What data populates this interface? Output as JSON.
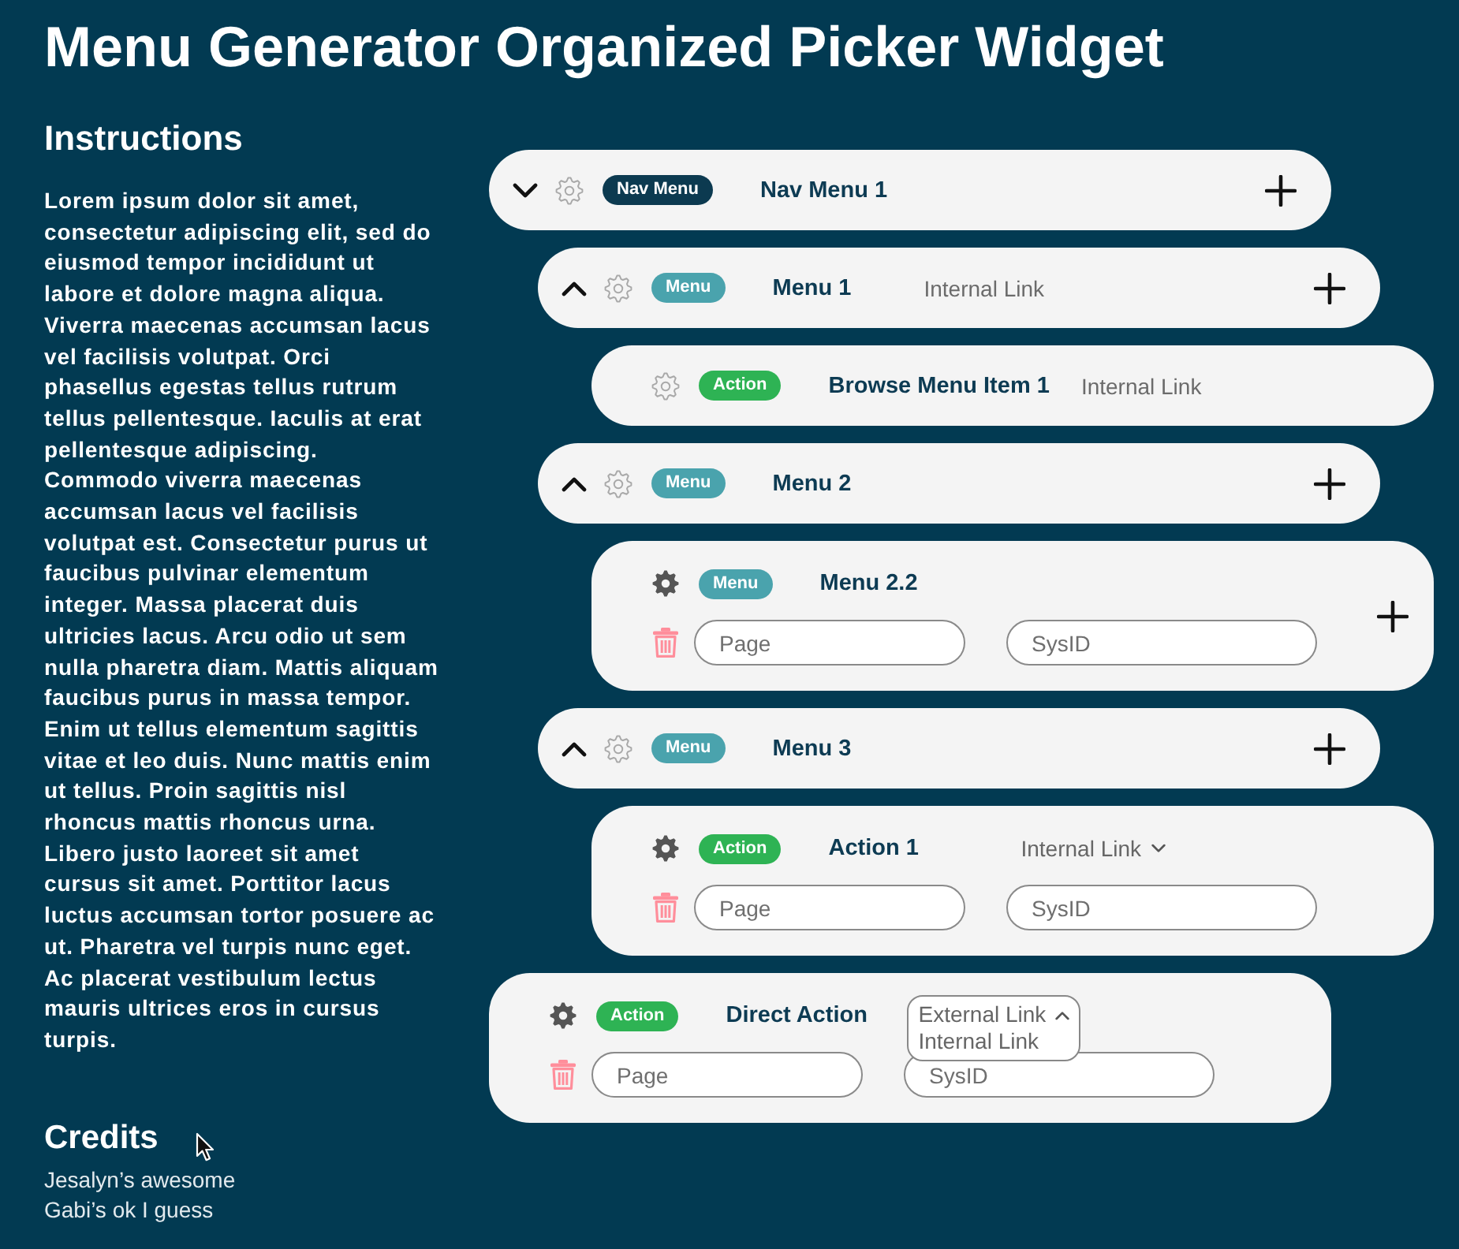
{
  "title": "Menu Generator Organized Picker Widget",
  "instructions": {
    "heading": "Instructions",
    "text": "Lorem ipsum dolor sit amet, consectetur adipiscing elit, sed do eiusmod tempor incididunt ut labore et dolore magna aliqua. Viverra maecenas accumsan lacus vel facilisis volutpat. Orci phasellus egestas tellus rutrum tellus pellentesque. Iaculis at erat pellentesque adipiscing. Commodo viverra maecenas accumsan lacus vel facilisis volutpat est. Consectetur purus ut faucibus pulvinar elementum integer. Massa placerat duis ultricies lacus. Arcu odio ut sem nulla pharetra diam. Mattis aliquam faucibus purus in massa tempor. Enim ut tellus elementum sagittis vitae et leo duis. Nunc mattis enim ut tellus. Proin sagittis nisl rhoncus mattis rhoncus urna. Libero justo laoreet sit amet cursus sit amet. Porttitor lacus luctus accumsan tortor posuere ac ut. Pharetra vel turpis nunc eget. Ac placerat vestibulum lectus mauris ultrices eros in cursus turpis."
  },
  "credits": {
    "heading": "Credits",
    "lines": [
      "Jesalyn’s awesome",
      "Gabi’s ok I guess"
    ]
  },
  "tree": [
    {
      "kind": "row",
      "expanded": false,
      "badge": {
        "text": "Nav Menu",
        "color": "#0c3a50"
      },
      "label": "Nav Menu 1",
      "add_button": true,
      "children": [
        {
          "kind": "row",
          "expanded": true,
          "badge": {
            "text": "Menu",
            "color": "#4aa3ad"
          },
          "label": "Menu 1",
          "link": "Internal Link",
          "add_button": true,
          "children": [
            {
              "kind": "row",
              "badge": {
                "text": "Action",
                "color": "#2eb354"
              },
              "label": "Browse Menu Item 1",
              "link": "Internal Link",
              "add_button": false
            }
          ]
        },
        {
          "kind": "row",
          "expanded": true,
          "badge": {
            "text": "Menu",
            "color": "#4aa3ad"
          },
          "label": "Menu 2",
          "add_button": true,
          "children": [
            {
              "kind": "form",
              "badge": {
                "text": "Menu",
                "color": "#4aa3ad"
              },
              "label": "Menu 2.2",
              "fields": [
                {
                  "placeholder": "Page"
                },
                {
                  "placeholder": "SysID"
                }
              ],
              "add_button": true
            }
          ]
        },
        {
          "kind": "row",
          "expanded": true,
          "badge": {
            "text": "Menu",
            "color": "#4aa3ad"
          },
          "label": "Menu 3",
          "add_button": true,
          "children": [
            {
              "kind": "form",
              "badge": {
                "text": "Action",
                "color": "#2eb354"
              },
              "label": "Action 1",
              "link_select": {
                "value": "Internal Link",
                "open": false
              },
              "fields": [
                {
                  "placeholder": "Page"
                },
                {
                  "placeholder": "SysID"
                }
              ],
              "add_button": false
            }
          ]
        }
      ]
    },
    {
      "kind": "form",
      "badge": {
        "text": "Action",
        "color": "#2eb354"
      },
      "label": "Direct Action",
      "link_select": {
        "value": "External Link",
        "open": true,
        "options": [
          "Internal Link"
        ]
      },
      "fields": [
        {
          "placeholder": "Page"
        },
        {
          "placeholder": "SysID"
        }
      ],
      "add_button": false
    }
  ]
}
